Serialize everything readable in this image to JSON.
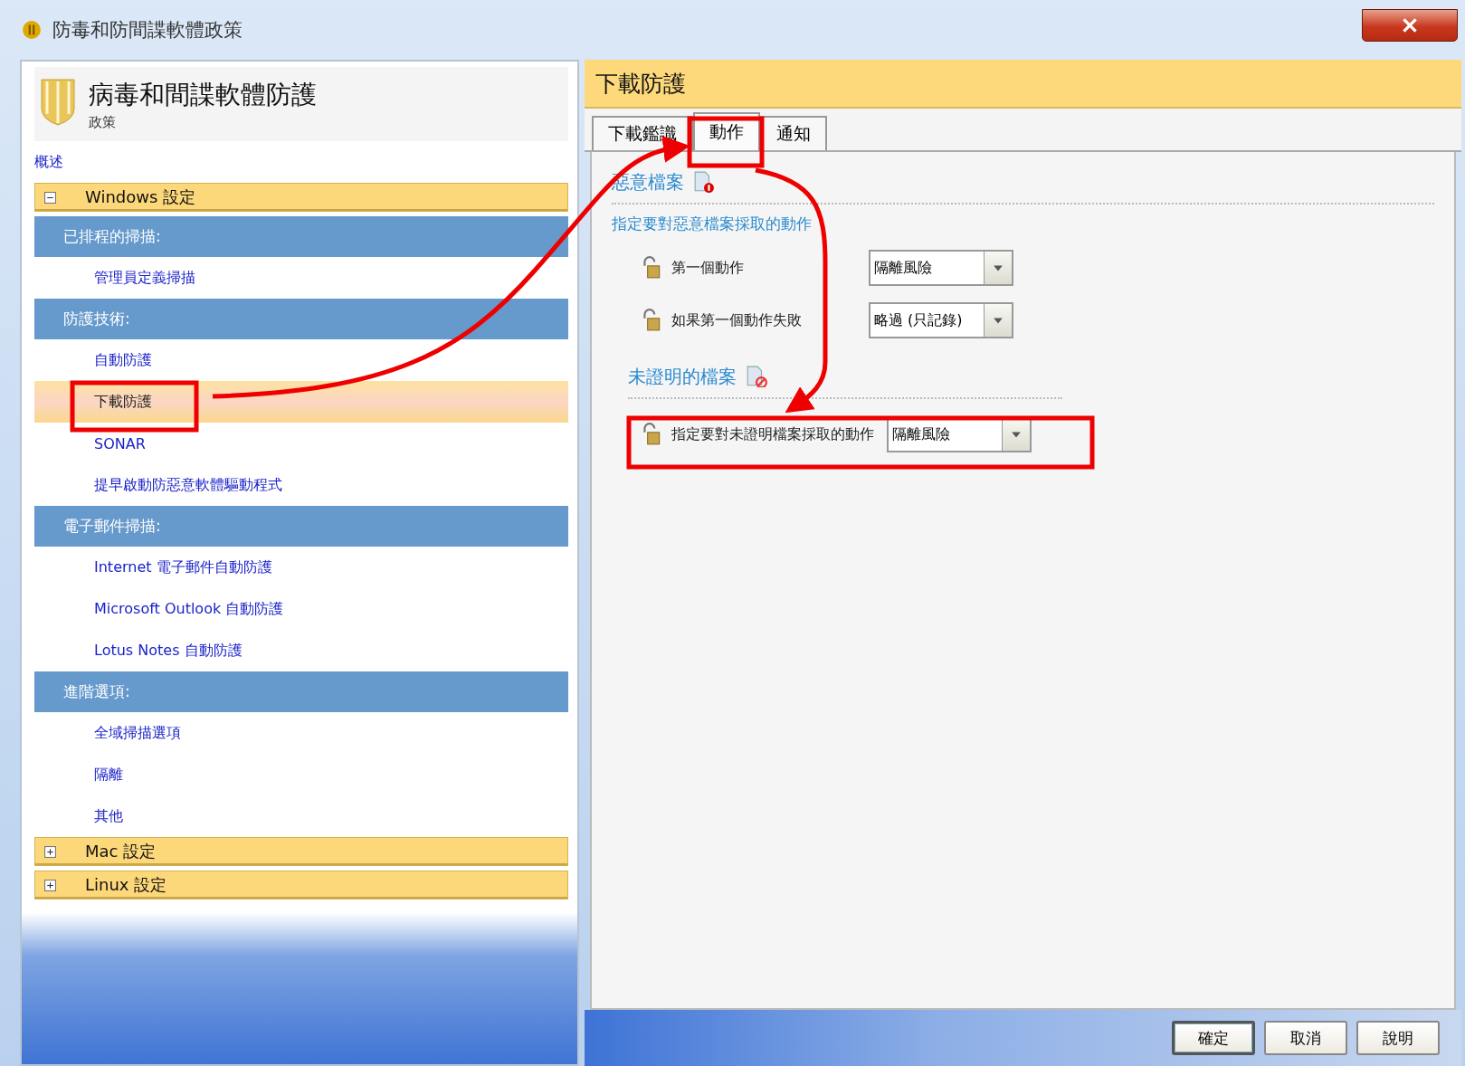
{
  "window": {
    "title": "防毒和防間諜軟體政策"
  },
  "sidebar": {
    "title": "病毒和間諜軟體防護",
    "subtitle": "政策",
    "overview": "概述",
    "groups": [
      {
        "label": "Windows 設定",
        "expanded": true,
        "sections": [
          {
            "header": "已排程的掃描:",
            "items": [
              {
                "label": "管理員定義掃描",
                "selected": false
              }
            ]
          },
          {
            "header": "防護技術:",
            "items": [
              {
                "label": "自動防護",
                "selected": false
              },
              {
                "label": "下載防護",
                "selected": true
              },
              {
                "label": "SONAR",
                "selected": false
              },
              {
                "label": "提早啟動防惡意軟體驅動程式",
                "selected": false
              }
            ]
          },
          {
            "header": "電子郵件掃描:",
            "items": [
              {
                "label": "Internet 電子郵件自動防護",
                "selected": false
              },
              {
                "label": "Microsoft Outlook 自動防護",
                "selected": false
              },
              {
                "label": "Lotus Notes 自動防護",
                "selected": false
              }
            ]
          },
          {
            "header": "進階選項:",
            "items": [
              {
                "label": "全域掃描選項",
                "selected": false
              },
              {
                "label": "隔離",
                "selected": false
              },
              {
                "label": "其他",
                "selected": false
              }
            ]
          }
        ]
      },
      {
        "label": "Mac 設定",
        "expanded": false
      },
      {
        "label": "Linux 設定",
        "expanded": false
      }
    ]
  },
  "panel": {
    "title": "下載防護",
    "tabs": [
      {
        "label": "下載鑑識",
        "selected": false
      },
      {
        "label": "動作",
        "selected": true
      },
      {
        "label": "通知",
        "selected": false
      }
    ],
    "sections": [
      {
        "title": "惡意檔案",
        "kind": "malicious",
        "description": "指定要對惡意檔案採取的動作",
        "rows": [
          {
            "label": "第一個動作",
            "value": "隔離風險"
          },
          {
            "label": "如果第一個動作失敗",
            "value": "略過 (只記錄)"
          }
        ]
      },
      {
        "title": "未證明的檔案",
        "kind": "unproven",
        "rows": [
          {
            "label": "指定要對未證明檔案採取的動作",
            "value": "隔離風險"
          }
        ]
      }
    ]
  },
  "buttons": [
    {
      "label": "確定",
      "default": true
    },
    {
      "label": "取消",
      "default": false
    },
    {
      "label": "說明",
      "default": false
    }
  ]
}
